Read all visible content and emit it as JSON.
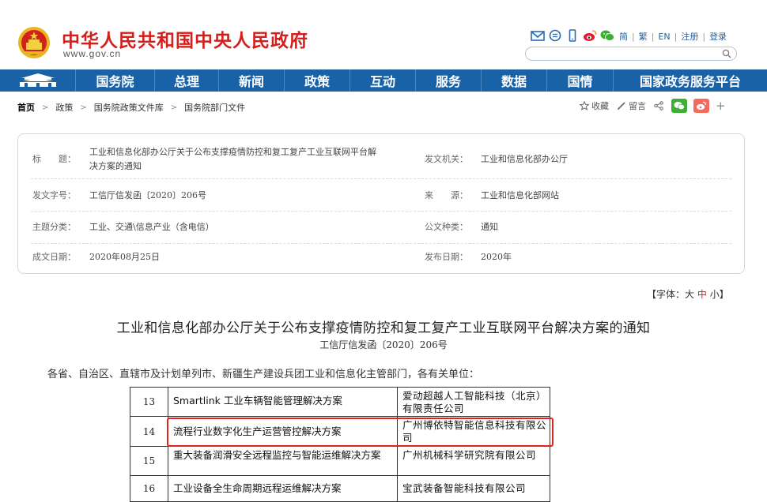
{
  "header": {
    "site_title": "中华人民共和国中央人民政府",
    "site_domain": "www.gov.cn",
    "lang_links": [
      "简",
      "繁",
      "EN",
      "注册",
      "登录"
    ],
    "share_icons": [
      "mail-icon",
      "message-icon",
      "mobile-icon",
      "weibo-icon",
      "wechat-icon"
    ],
    "colors": {
      "brand_red": "#d4201c",
      "nav_blue": "#1a62a8"
    }
  },
  "nav": {
    "items": [
      "国务院",
      "总理",
      "新闻",
      "政策",
      "互动",
      "服务",
      "数据",
      "国情",
      "国家政务服务平台"
    ]
  },
  "breadcrumb": {
    "items": [
      "首页",
      "政策",
      "国务院政策文件库",
      "国务院部门文件"
    ]
  },
  "tools": {
    "favorite": "收藏",
    "comment": "留言",
    "plus": "+"
  },
  "meta": {
    "title_label": "标　　题：",
    "title_value_line1": "工业和信息化部办公厅关于公布支撑疫情防控和复工复产工业互联网平台解",
    "title_value_line2": "决方案的通知",
    "issuer_label": "发文机关：",
    "issuer_value": "工业和信息化部办公厅",
    "doc_no_label": "发文字号：",
    "doc_no_value": "工信厅信发函〔2020〕206号",
    "source_label": "来　　源：",
    "source_value": "工业和信息化部网站",
    "topic_label": "主题分类：",
    "topic_value": "工业、交通\\信息产业（含电信）",
    "type_label": "公文种类：",
    "type_value": "通知",
    "written_label": "成文日期：",
    "written_value": "2020年08月25日",
    "published_label": "发布日期：",
    "published_value": "2020年"
  },
  "font_control": {
    "prefix": "【字体：",
    "large": "大",
    "medium": "中",
    "small": "小",
    "suffix": "】"
  },
  "document": {
    "title": "工业和信息化部办公厅关于公布支撑疫情防控和复工复产工业互联网平台解决方案的通知",
    "number": "工信厅信发函〔2020〕206号",
    "recipients": "各省、自治区、直辖市及计划单列市、新疆生产建设兵团工业和信息化主管部门，各有关单位："
  },
  "table": {
    "rows": [
      {
        "num": "13",
        "name": "Smartlink 工业车辆智能管理解决方案",
        "org": "爱动超越人工智能科技（北京）有限责任公司"
      },
      {
        "num": "14",
        "name": "流程行业数字化生产运营管控解决方案",
        "org": "广州博依特智能信息科技有限公司"
      },
      {
        "num": "15",
        "name": "重大装备润滑安全远程监控与智能运维解决方案",
        "org": "广州机械科学研究院有限公司"
      },
      {
        "num": "16",
        "name": "工业设备全生命周期远程运维解决方案",
        "org": "宝武装备智能科技有限公司"
      }
    ]
  }
}
